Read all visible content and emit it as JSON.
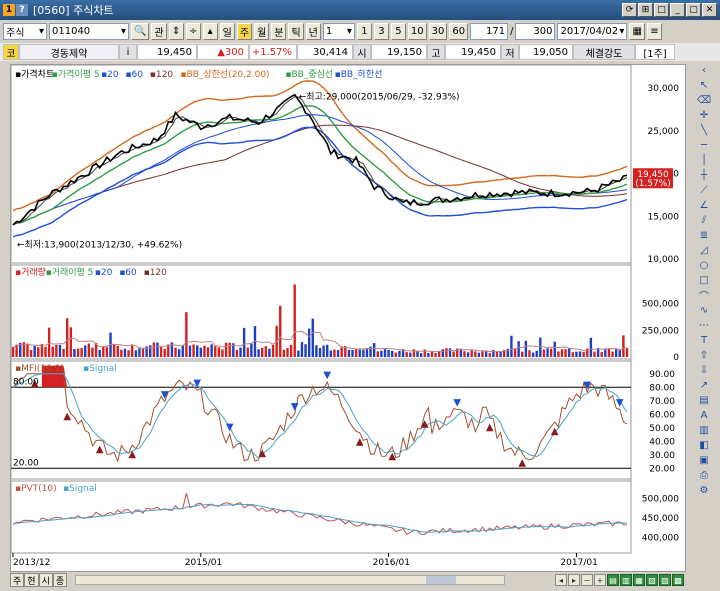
{
  "window": {
    "title": "[0560] 주식차트"
  },
  "toolbar1": {
    "market": "주식",
    "code": "011040",
    "btn_gwan": "관",
    "btn_updown": "⇕",
    "periods": [
      "일",
      "주",
      "월",
      "분",
      "틱",
      "년"
    ],
    "active_period": "주",
    "interval": "1",
    "quick": [
      "1",
      "3",
      "5",
      "10",
      "30",
      "60"
    ],
    "count_a": "171",
    "count_b": "300",
    "date": "2017/04/02"
  },
  "toolbar2": {
    "code_lbl": "코",
    "name": "경동제약",
    "info": "i",
    "price": "19,450",
    "change": "▲300",
    "pct": "+1.57%",
    "volume": "30,414",
    "open_lbl": "시",
    "open": "19,150",
    "high_lbl": "고",
    "high": "19,450",
    "low_lbl": "저",
    "low": "19,050",
    "strength_lbl": "체결강도",
    "unit": "[1주]"
  },
  "price_panel": {
    "legend": [
      "가격차트",
      "가격이평 5",
      "20",
      "60",
      "120",
      "BB_상한선(20,2.00)",
      "BB_중심선",
      "BB_하한선"
    ],
    "high_note": "최고:29,000(2015/06/29, -32.93%)",
    "low_note": "최저:13,900(2013/12/30, +49.62%)",
    "current_label": "19,450",
    "current_pct": "(1.57%)",
    "y_ticks": [
      "30,000",
      "25,000",
      "20,000",
      "15,000",
      "10,000"
    ]
  },
  "volume_panel": {
    "legend": [
      "거래량",
      "거래이평 5",
      "20",
      "60",
      "120"
    ],
    "y_ticks": [
      "500,000",
      "250,000",
      "0"
    ]
  },
  "mfi_panel": {
    "legend": [
      "MFI(14,9)",
      "Signal"
    ],
    "level_hi": "80.00",
    "level_lo": "20.00",
    "y_ticks": [
      "90.00",
      "80.00",
      "70.00",
      "60.00",
      "50.00",
      "40.00",
      "30.00",
      "20.00"
    ]
  },
  "pvt_panel": {
    "legend": [
      "PVT(10)",
      "Signal"
    ],
    "y_ticks": [
      "500,000",
      "450,000",
      "400,000"
    ]
  },
  "x_axis": [
    "2013/12",
    "2015/01",
    "2016/01",
    "2017/01"
  ],
  "bottom_tabs": [
    "주",
    "현",
    "시",
    "종"
  ],
  "colors": {
    "price": "#000000",
    "ma5": "#000000",
    "ma20": "#2f9e44",
    "ma60": "#1d4fd7",
    "ma120": "#7a2e2e",
    "bb_upper": "#d2691e",
    "bb_mid": "#2f9e44",
    "bb_lower": "#1d4fd7",
    "vol_up": "#d42020",
    "vol_down": "#1d3fbf",
    "mfi": "#a0522d",
    "signal": "#4aa3c8",
    "current_bg": "#d42020"
  }
}
